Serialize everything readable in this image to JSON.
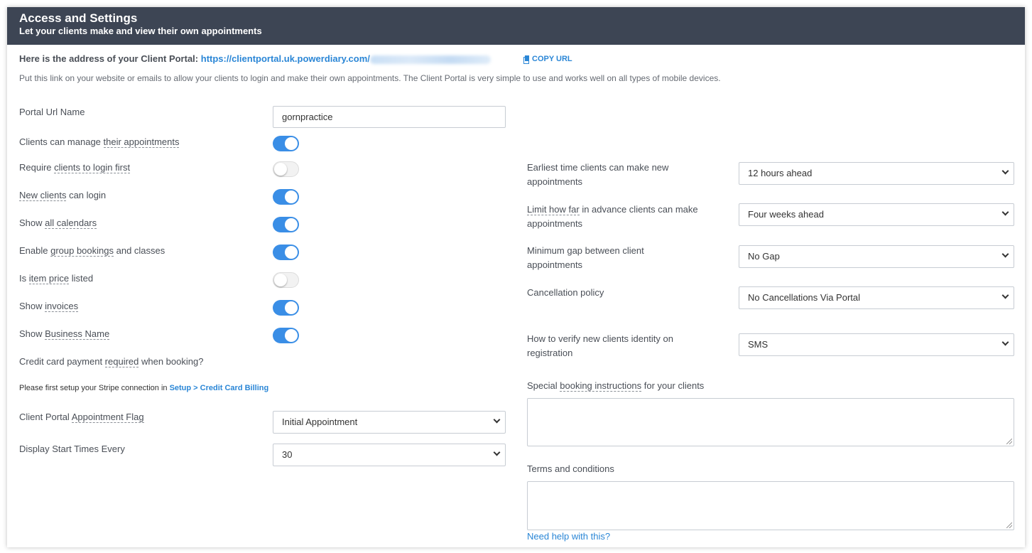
{
  "header": {
    "title": "Access and Settings",
    "subtitle": "Let your clients make and view their own appointments"
  },
  "portal_address": {
    "prefix": "Here is the address of your Client Portal:",
    "url": "https://clientportal.uk.powerdiary.com/",
    "copy_label": "COPY URL",
    "description": "Put this link on your website or emails to allow your clients to login and make their own appointments. The Client Portal is very simple to use and works well on all types of mobile devices."
  },
  "left": {
    "portal_url_name": {
      "label": "Portal Url Name",
      "value": "gornpractice"
    },
    "toggles": [
      {
        "pre": "Clients can manage ",
        "u": "their appointments",
        "post": "",
        "on": true
      },
      {
        "pre": "Require ",
        "u": "clients to login first",
        "post": "",
        "on": false
      },
      {
        "pre": "",
        "u": "New clients",
        "post": " can login",
        "on": true
      },
      {
        "pre": "Show ",
        "u": "all calendars",
        "post": "",
        "on": true
      },
      {
        "pre": "Enable ",
        "u": "group bookings",
        "post": " and classes",
        "on": true
      },
      {
        "pre": "Is ",
        "u": "item price",
        "post": " listed",
        "on": false
      },
      {
        "pre": "Show ",
        "u": "invoices",
        "post": "",
        "on": true
      },
      {
        "pre": "Show ",
        "u": "Business Name",
        "post": "",
        "on": true
      }
    ],
    "credit_card": {
      "pre": "Credit card payment ",
      "u": "required",
      "post": " when booking?"
    },
    "stripe_note": {
      "text": "Please first setup your Stripe connection in ",
      "link": "Setup > Credit Card Billing"
    },
    "appointment_flag": {
      "pre": "Client Portal ",
      "u": "Appointment Flag",
      "value": "Initial Appointment"
    },
    "start_times": {
      "label": "Display Start Times Every",
      "value": "30"
    }
  },
  "right": {
    "earliest": {
      "label_line1": "Earliest time clients can make new",
      "label_line2": "appointments",
      "value": "12 hours ahead"
    },
    "limit": {
      "u": "Limit how far",
      "post": " in advance clients can make",
      "line2": "appointments",
      "value": "Four weeks ahead"
    },
    "gap": {
      "label_line1": "Minimum gap between client",
      "label_line2": "appointments",
      "value": "No Gap"
    },
    "cancellation": {
      "label": "Cancellation policy",
      "value": "No Cancellations Via Portal"
    },
    "verify": {
      "label_line1": "How to verify new clients identity on",
      "label_line2": "registration",
      "value": "SMS"
    },
    "instructions": {
      "pre": "Special ",
      "u": "booking instructions",
      "post": " for your clients",
      "value": ""
    },
    "terms": {
      "label": "Terms and conditions",
      "value": ""
    },
    "help_link": "Need help with this?"
  },
  "colors": {
    "header_bg": "#3d4554",
    "accent": "#2a86d6",
    "toggle_on": "#3a8ee6"
  }
}
